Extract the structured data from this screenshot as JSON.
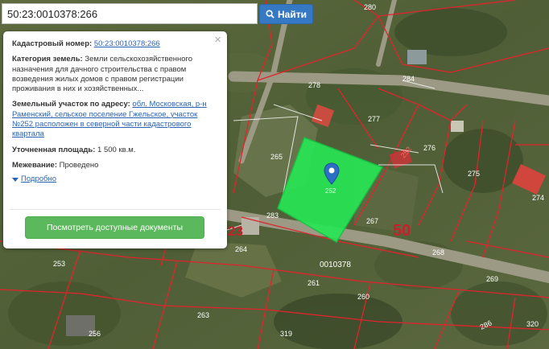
{
  "search": {
    "value": "50:23:0010378:266",
    "button_label": "Найти"
  },
  "popup": {
    "close_glyph": "×",
    "cadastral_label": "Кадастровый номер:",
    "cadastral_value": "50:23:0010378:266",
    "category_label": "Категория земель:",
    "category_value": "Земли сельскохозяйственного назначения для дачного строительства с правом возведения жилых домов с правом регистрации проживания в них и хозяйственных...",
    "address_label": "Земельный участок по адресу:",
    "address_value": "обл. Московская, р-н Раменский, сельское поселение Гжельское, участок №252 расположен в северной части кадастрового квартала",
    "area_label": "Уточненная площадь:",
    "area_value": "1 500 кв.м.",
    "survey_label": "Межевание:",
    "survey_value": "Проведено",
    "more_label": "Подробно",
    "docs_button": "Посмотреть доступные документы"
  },
  "map": {
    "parcel_labels": [
      "280",
      "278",
      "284",
      "277",
      "276",
      "265",
      "275",
      "274",
      "283",
      "267",
      "264",
      "268",
      "253",
      "261",
      "269",
      "263",
      "260",
      "256",
      "319",
      "286",
      "320",
      "252"
    ],
    "quarter_fragment": "0010378",
    "zone_label": "50",
    "zone_label_left": "23",
    "colors": {
      "highlight": "#27e655",
      "boundary": "#e2232d",
      "pin": "#2e6fc6",
      "button": "#3579c5",
      "docs_button": "#5cb85c"
    }
  }
}
